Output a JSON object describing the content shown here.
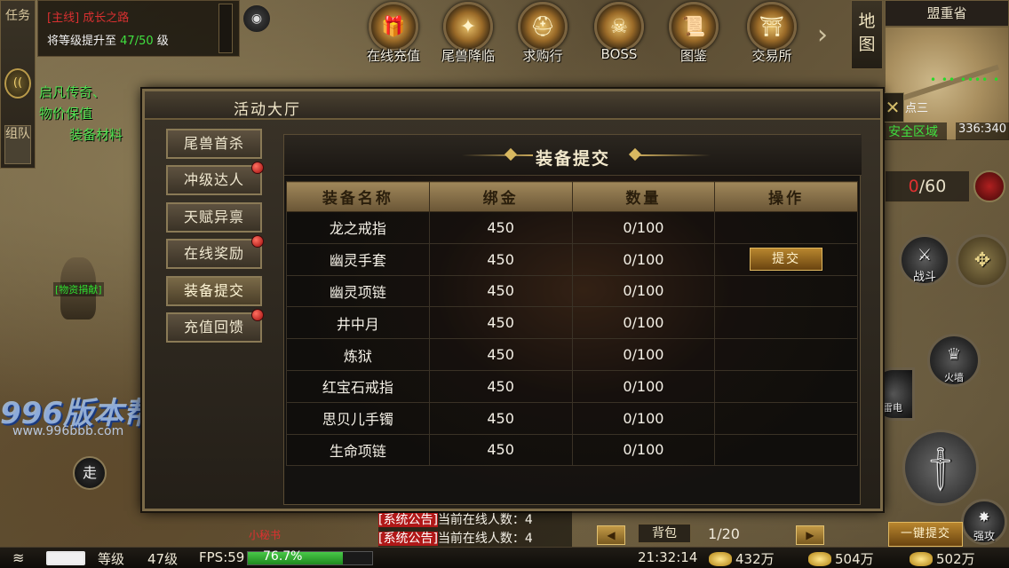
{
  "left_tabs": [
    "任务",
    "组队"
  ],
  "quest": {
    "title": "[主线] 成长之路",
    "line_prefix": "将等级提升至",
    "progress": "47/50",
    "line_suffix": "级"
  },
  "left_notice": [
    "启凡传奇、",
    "物价保值",
    "装备材料"
  ],
  "top_menu": [
    {
      "label": "在线充值",
      "icon": "gift-box-icon"
    },
    {
      "label": "尾兽降临",
      "icon": "beast-emblem-icon"
    },
    {
      "label": "求购行",
      "icon": "warrior-helmet-icon"
    },
    {
      "label": "BOSS",
      "icon": "boss-skull-icon"
    },
    {
      "label": "图鉴",
      "icon": "scroll-book-icon"
    },
    {
      "label": "交易所",
      "icon": "pagoda-icon"
    }
  ],
  "map": {
    "button": "地图",
    "region": "盟重省",
    "safe_zone": "安全区域",
    "coords": "336:340",
    "spot": "点三"
  },
  "bag_counter": {
    "current": "0",
    "max": "/60"
  },
  "skills": [
    {
      "label": "战斗"
    },
    {
      "label": "火墙"
    },
    {
      "label": "雷电"
    },
    {
      "label": "强攻"
    }
  ],
  "dialog": {
    "title": "活动大厅",
    "sidebar": [
      {
        "label": "尾兽首杀",
        "badge": false,
        "active": false
      },
      {
        "label": "冲级达人",
        "badge": true,
        "active": false
      },
      {
        "label": "天赋异禀",
        "badge": false,
        "active": false
      },
      {
        "label": "在线奖励",
        "badge": true,
        "active": false
      },
      {
        "label": "装备提交",
        "badge": false,
        "active": true
      },
      {
        "label": "充值回馈",
        "badge": true,
        "active": false
      }
    ],
    "content_title": "装备提交",
    "columns": [
      "装备名称",
      "绑金",
      "数量",
      "操作"
    ],
    "rows": [
      {
        "name": "龙之戒指",
        "gold": "450",
        "qty": "0/100",
        "action": ""
      },
      {
        "name": "幽灵手套",
        "gold": "450",
        "qty": "0/100",
        "action": "提交"
      },
      {
        "name": "幽灵项链",
        "gold": "450",
        "qty": "0/100",
        "action": ""
      },
      {
        "name": "井中月",
        "gold": "450",
        "qty": "0/100",
        "action": ""
      },
      {
        "name": "炼狱",
        "gold": "450",
        "qty": "0/100",
        "action": ""
      },
      {
        "name": "红宝石戒指",
        "gold": "450",
        "qty": "0/100",
        "action": ""
      },
      {
        "name": "思贝儿手镯",
        "gold": "450",
        "qty": "0/100",
        "action": ""
      },
      {
        "name": "生命项链",
        "gold": "450",
        "qty": "0/100",
        "action": ""
      }
    ],
    "pager": {
      "text": "1/20"
    },
    "bulk_button": "一键提交"
  },
  "watermark": {
    "brand": "996版本帮",
    "url": "www.996bbb.com"
  },
  "player_tag": "[物资捐献]",
  "walk_button": "走",
  "xiaomishu": "小秘书",
  "chat": [
    {
      "tag": "[系统公告]",
      "text": "当前在线人数：4"
    },
    {
      "tag": "[系统公告]",
      "text": "当前在线人数：4"
    },
    {
      "tag": "[系统公告]",
      "text": "当前在线人数：4"
    }
  ],
  "bag_tab": "背包",
  "status": {
    "level_label": "等级",
    "level_value": "47级",
    "fps": "FPS:59",
    "fps_pct": "76.7%",
    "fps_fraction": 0.767,
    "time": "21:32:14",
    "gold": "432万",
    "bound_gold": "504万",
    "ingot": "502万"
  },
  "colors": {
    "accent_gold": "#c9a85a",
    "alert_red": "#e03030",
    "safe_green": "#40e040"
  }
}
